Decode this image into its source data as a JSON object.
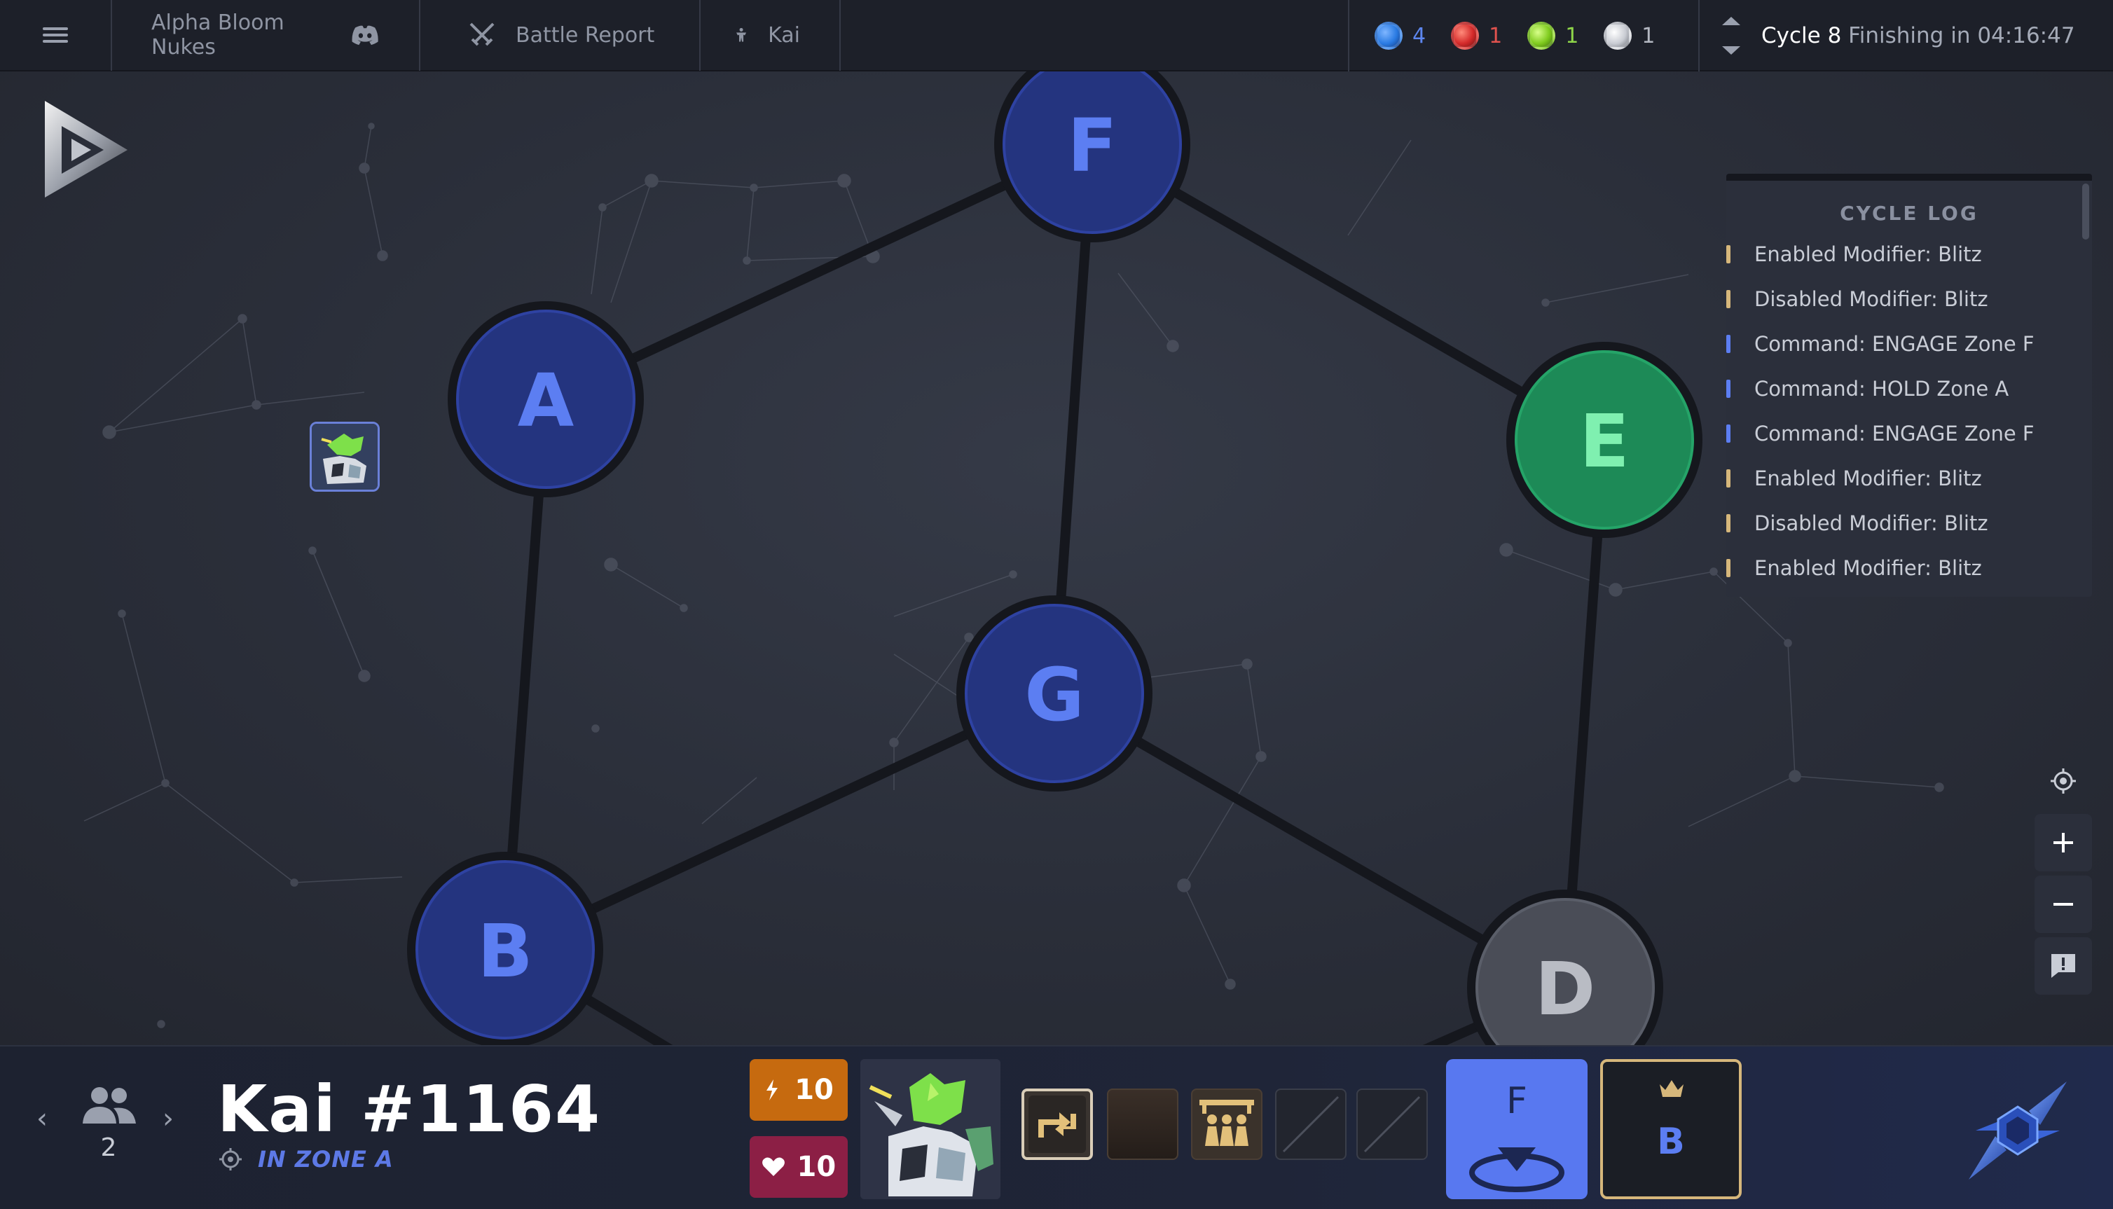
{
  "topbar": {
    "menu_icon": "hamburger-icon",
    "tabs": [
      {
        "label": "Alpha Bloom Nukes",
        "icon": "discord-icon"
      },
      {
        "label": "Battle Report",
        "icon": "crossed-swords-icon"
      },
      {
        "label": "Kai",
        "icon": "mech-figure-icon"
      }
    ],
    "resources": [
      {
        "color": "#2a7be3",
        "count": "4",
        "text_color": "#5d86ee"
      },
      {
        "color": "#d42a2a",
        "count": "1",
        "text_color": "#e0524e"
      },
      {
        "color": "#7fcb1e",
        "count": "1",
        "text_color": "#8fd649"
      },
      {
        "color": "#c9ccd3",
        "count": "1",
        "text_color": "#b4b8c2"
      }
    ],
    "cycle": {
      "label": "Cycle 8",
      "status": "Finishing in 04:16:47"
    }
  },
  "map": {
    "zones": [
      {
        "id": "F",
        "label": "F",
        "color": "#24347f",
        "text_color": "#5c7ef2"
      },
      {
        "id": "A",
        "label": "A",
        "color": "#24347f",
        "text_color": "#5c7ef2"
      },
      {
        "id": "E",
        "label": "E",
        "color": "#1d8a57",
        "text_color": "#7ff0b0"
      },
      {
        "id": "G",
        "label": "G",
        "color": "#24347f",
        "text_color": "#5c7ef2"
      },
      {
        "id": "B",
        "label": "B",
        "color": "#24347f",
        "text_color": "#5c7ef2"
      },
      {
        "id": "D",
        "label": "D",
        "color": "#4a4d57",
        "text_color": "#b9bcc4"
      }
    ],
    "cycle_log": {
      "title": "CYCLE LOG",
      "entries": [
        {
          "text": "Enabled Modifier: Blitz",
          "mark_color": "#d6b77b"
        },
        {
          "text": "Disabled Modifier: Blitz",
          "mark_color": "#d6b77b"
        },
        {
          "text": "Command: ENGAGE Zone F",
          "mark_color": "#5c7ef2"
        },
        {
          "text": "Command: HOLD Zone A",
          "mark_color": "#5c7ef2"
        },
        {
          "text": "Command: ENGAGE Zone F",
          "mark_color": "#5c7ef2"
        },
        {
          "text": "Enabled Modifier: Blitz",
          "mark_color": "#d6b77b"
        },
        {
          "text": "Disabled Modifier: Blitz",
          "mark_color": "#d6b77b"
        },
        {
          "text": "Enabled Modifier: Blitz",
          "mark_color": "#d6b77b"
        }
      ]
    },
    "controls": [
      "locate-icon",
      "zoom-in-icon",
      "zoom-out-icon",
      "report-icon"
    ]
  },
  "bottombar": {
    "squad_count": "2",
    "unit_name": "Kai #1164",
    "unit_zone": "IN ZONE A",
    "energy": "10",
    "health": "10",
    "energy_color": "#c66a0f",
    "health_color": "#8c1f45",
    "command_target": "F",
    "command_icon": "engage-zone-icon",
    "hold_zone": "B",
    "hold_icon": "crown-icon"
  }
}
